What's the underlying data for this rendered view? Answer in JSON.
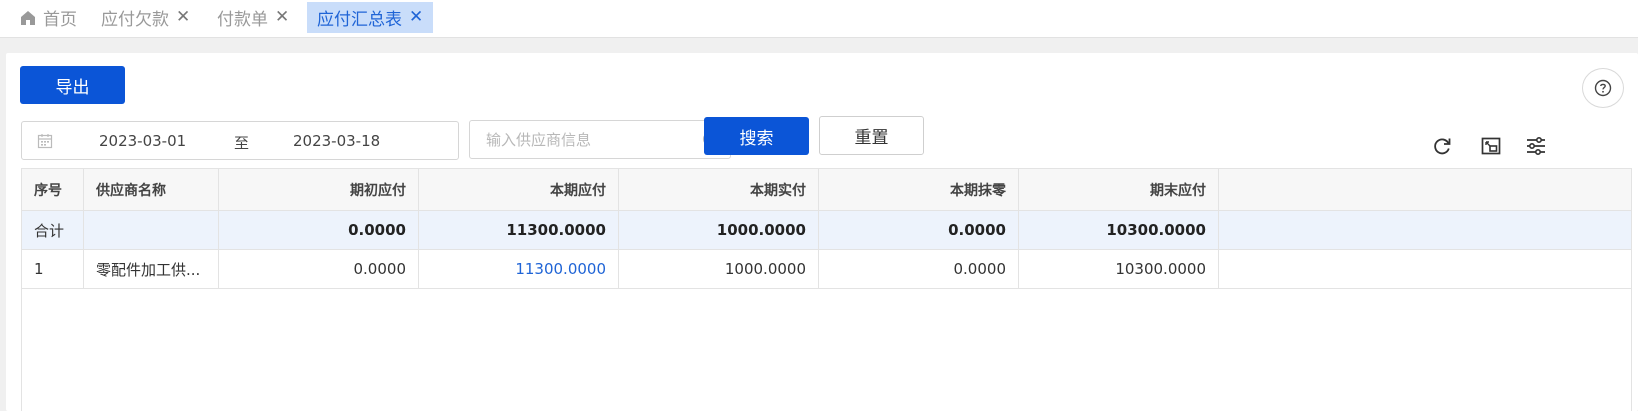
{
  "tabs": [
    {
      "label": "首页",
      "icon": "home-icon"
    },
    {
      "label": "应付欠款",
      "close": "✕"
    },
    {
      "label": "付款单",
      "close": "✕"
    },
    {
      "label": "应付汇总表",
      "close": "✕",
      "active": true
    }
  ],
  "toolbar": {
    "export_label": "导出",
    "search_label": "搜索",
    "reset_label": "重置",
    "help_icon": "help-circle-icon"
  },
  "filters": {
    "date_start": "2023-03-01",
    "date_separator": "至",
    "date_end": "2023-03-18",
    "supplier_placeholder": "输入供应商信息",
    "supplier_value": ""
  },
  "grid_tools": [
    "refresh-icon",
    "fullscreen-icon",
    "column-settings-icon"
  ],
  "table": {
    "headers": [
      "序号",
      "供应商名称",
      "期初应付",
      "本期应付",
      "本期实付",
      "本期抹零",
      "期末应付"
    ],
    "total": {
      "label": "合计",
      "name": "",
      "opening": "0.0000",
      "current_payable": "11300.0000",
      "current_paid": "1000.0000",
      "current_writeoff": "0.0000",
      "closing": "10300.0000"
    },
    "rows": [
      {
        "index": "1",
        "name": "零配件加工供...",
        "opening": "0.0000",
        "current_payable": "11300.0000",
        "current_paid": "1000.0000",
        "current_writeoff": "0.0000",
        "closing": "10300.0000"
      }
    ]
  },
  "colors": {
    "primary": "#0b55d7",
    "active_tab_bg": "#c9ddfa",
    "link": "#1f64d6",
    "total_row_bg": "#edf3fc"
  }
}
